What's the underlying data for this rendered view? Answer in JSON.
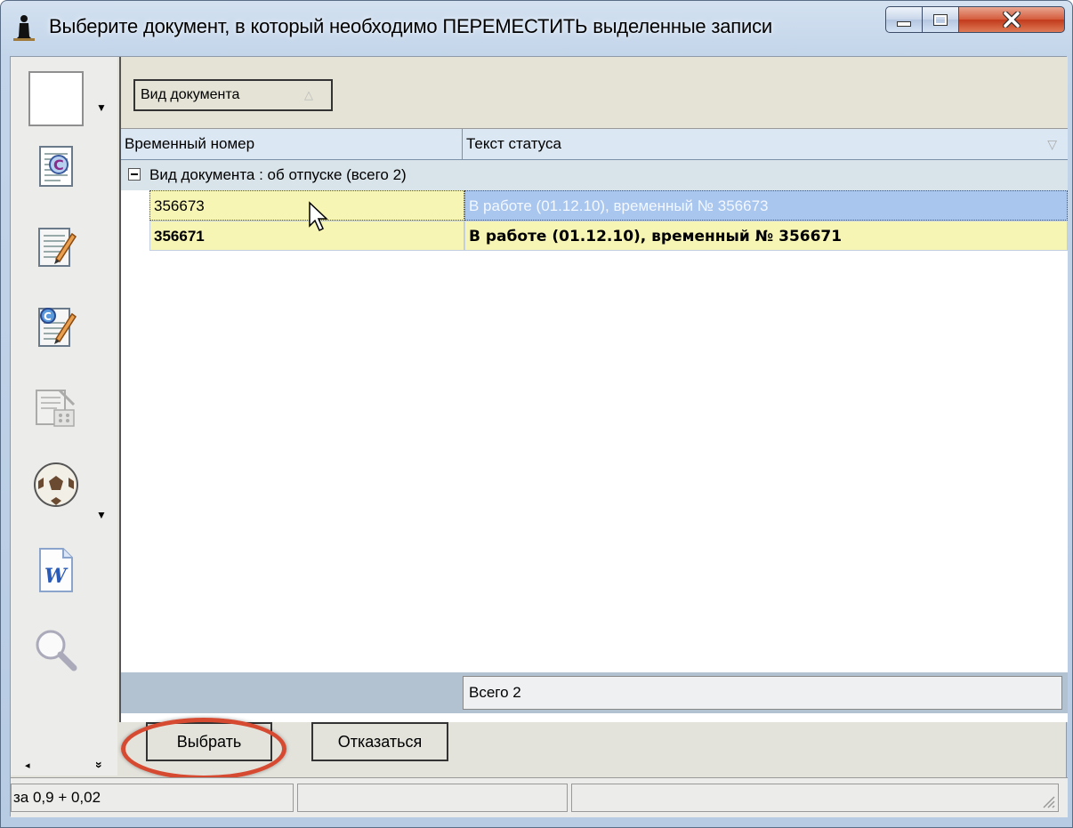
{
  "window": {
    "title": "Выберите документ, в который необходимо ПЕРЕМЕСТИТЬ выделенные записи"
  },
  "toolbar": {
    "icons": [
      "blank-document-icon",
      "document-c-icon",
      "document-edit-icon",
      "document-c-edit-icon",
      "form-settings-icon",
      "ball-icon",
      "word-document-icon",
      "magnifier-icon"
    ],
    "nav_left": "◂",
    "nav_more": "»"
  },
  "grid": {
    "group_by_label": "Вид документа",
    "columns": [
      "Временный номер",
      "Текст статуса"
    ],
    "group_row": "Вид документа : об отпуске (всего 2)",
    "rows": [
      {
        "number": "356673",
        "status": "В работе (01.12.10), временный № 356673"
      },
      {
        "number": "356671",
        "status": "В работе (01.12.10), временный № 356671"
      }
    ],
    "summary": "Всего 2"
  },
  "buttons": {
    "select": "Выбрать",
    "cancel": "Отказаться"
  },
  "statusbar": {
    "text": "за 0,9 + 0,02"
  },
  "colors": {
    "selected_row": "#a9c6ee",
    "bold_row": "#f7f5b4",
    "highlight": "#d64a32"
  }
}
